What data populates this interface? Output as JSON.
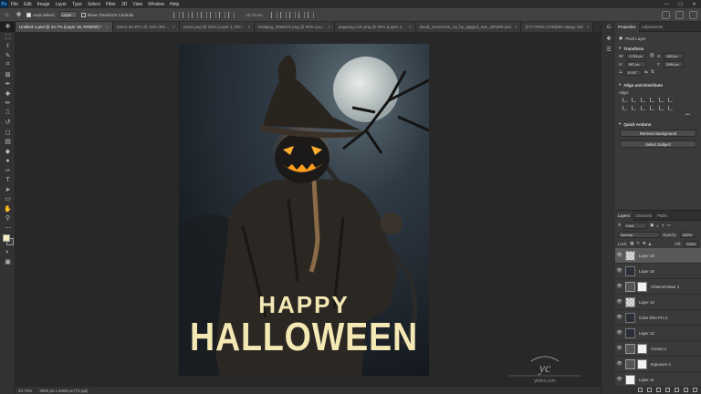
{
  "app": {
    "logo": "Ps"
  },
  "menu": [
    "File",
    "Edit",
    "Image",
    "Layer",
    "Type",
    "Select",
    "Filter",
    "3D",
    "View",
    "Window",
    "Help"
  ],
  "window_controls": [
    "—",
    "☐",
    "✕"
  ],
  "options_bar": {
    "auto_select_label": "Auto-Select:",
    "auto_select_target": "Layer",
    "show_transform_label": "Show Transform Controls",
    "mode_3d_label": "3D Mode:"
  },
  "tabs": [
    {
      "label": "Untitled-1.psd @ 22.7% (Layer 16, RGB/8#) *",
      "active": true
    },
    {
      "label": "Storm 09.JPG @ 16% (RG...",
      "active": false
    },
    {
      "label": "moon.png @ 25% (Layer 1, RG...",
      "active": false
    },
    {
      "label": "kindpng_3066375.png @ 50% (La...",
      "active": false
    },
    {
      "label": "pngwing.com.png @ 50% (Layer 1...",
      "active": false
    },
    {
      "label": "david_scarecrow_1a_by_jagged_eye_d3h490.psd",
      "active": false
    },
    {
      "label": "[CITYPNG.COM]HD Happy Hal",
      "active": false
    }
  ],
  "tools": [
    "move",
    "marquee",
    "lasso",
    "quick-select",
    "crop",
    "frame",
    "eyedropper",
    "healing",
    "brush",
    "clone-stamp",
    "history-brush",
    "eraser",
    "gradient",
    "blur",
    "dodge",
    "pen",
    "type",
    "path-select",
    "rectangle",
    "hand",
    "zoom",
    "more"
  ],
  "tool_glyphs": [
    "✥",
    "⬚",
    "ℓ",
    "✎",
    "⌗",
    "⊠",
    "✒",
    "✚",
    "✏",
    "⎍",
    "↺",
    "◻",
    "▤",
    "◆",
    "●",
    "✑",
    "T",
    "➤",
    "▭",
    "✋",
    "⚲",
    "⋯"
  ],
  "canvas": {
    "title_line1": "HAPPY",
    "title_line2": "HALLOWEEN",
    "title_color": "#f4e8b4"
  },
  "status": {
    "zoom": "22.72%",
    "doc_size": "3000 px x 4000 px (72 ppi)"
  },
  "properties": {
    "tabs": [
      "Properties",
      "Adjustments"
    ],
    "kind": "Pixel Layer",
    "transform_title": "Transform",
    "w_label": "W:",
    "w_value": "1733 px",
    "h_label": "H:",
    "h_value": "957 px",
    "x_label": "X:",
    "x_value": "583 px",
    "y_label": "Y:",
    "y_value": "2996 px",
    "angle_value": "0.00°",
    "align_title": "Align and Distribute",
    "align_label": "Align:",
    "quick_actions_title": "Quick Actions",
    "remove_bg_label": "Remove Background",
    "select_subject_label": "Select Subject",
    "more_dots": "•••"
  },
  "layers_panel": {
    "tabs": [
      "Layers",
      "Channels",
      "Paths"
    ],
    "filter_kind": "Kind",
    "blend_mode": "Normal",
    "opacity_label": "Opacity:",
    "opacity_value": "100%",
    "lock_label": "Lock:",
    "fill_label": "Fill:",
    "fill_value": "100%",
    "layers": [
      {
        "name": "Layer 16",
        "thumb": "light",
        "selected": true,
        "locked": false
      },
      {
        "name": "Layer 15",
        "thumb": "dark",
        "selected": false,
        "locked": false
      },
      {
        "name": "Channel Mixer 1",
        "thumb": "adj",
        "selected": false,
        "locked": false
      },
      {
        "name": "Layer 14",
        "thumb": "light",
        "selected": false,
        "locked": false
      },
      {
        "name": "Color Efex Pro 4",
        "thumb": "dark",
        "selected": false,
        "locked": false
      },
      {
        "name": "Layer 12",
        "thumb": "dark",
        "selected": false,
        "locked": false
      },
      {
        "name": "Curves 1",
        "thumb": "adj",
        "selected": false,
        "locked": false
      },
      {
        "name": "Exposure 4",
        "thumb": "adj",
        "selected": false,
        "locked": false
      },
      {
        "name": "Layer 11",
        "thumb": "white",
        "selected": false,
        "locked": false
      }
    ]
  },
  "watermark_text": "yk4ss.com"
}
